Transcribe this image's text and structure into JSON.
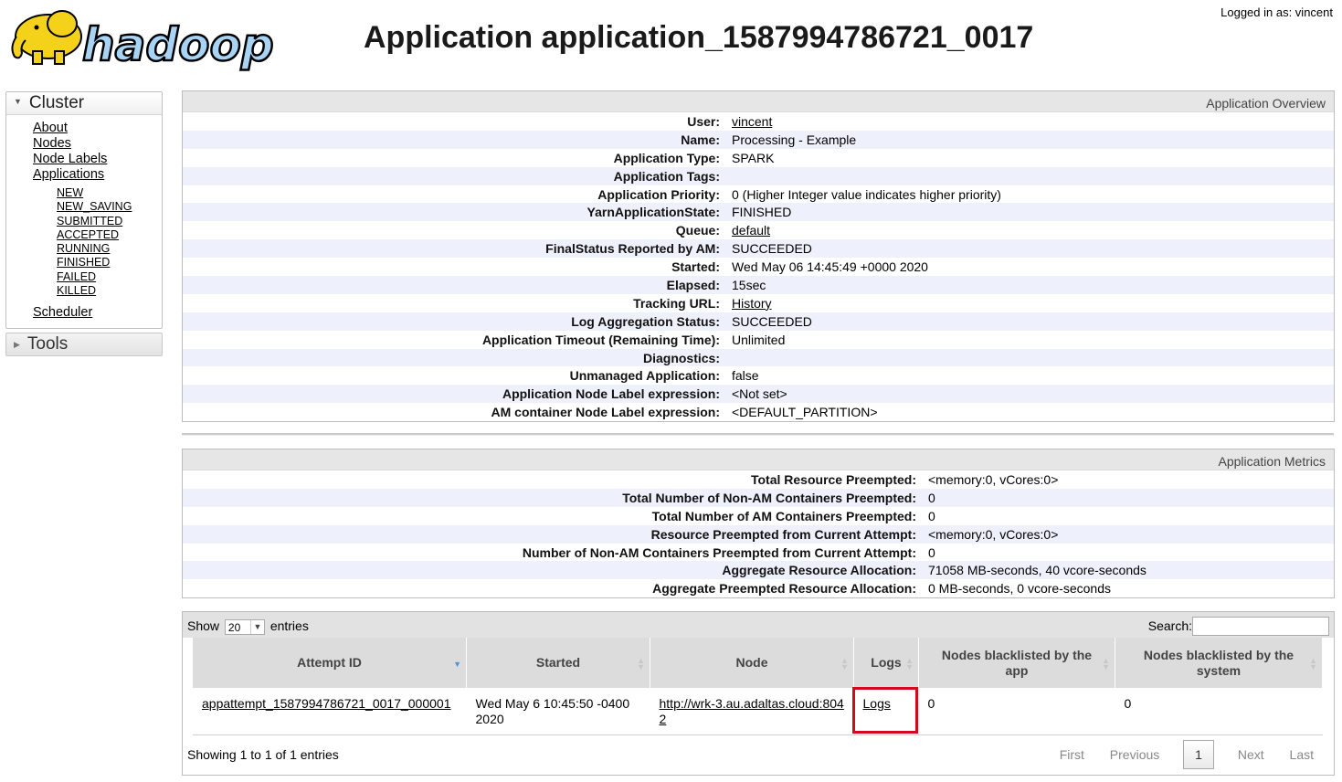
{
  "header": {
    "logo_text": "hadoop",
    "title": "Application application_1587994786721_0017",
    "login": "Logged in as: vincent"
  },
  "nav": {
    "cluster_label": "Cluster",
    "items": [
      "About",
      "Nodes",
      "Node Labels",
      "Applications"
    ],
    "states": [
      "NEW",
      "NEW_SAVING",
      "SUBMITTED",
      "ACCEPTED",
      "RUNNING",
      "FINISHED",
      "FAILED",
      "KILLED"
    ],
    "scheduler": "Scheduler",
    "tools_label": "Tools"
  },
  "overview": {
    "title": "Application Overview",
    "rows": [
      {
        "k": "User:",
        "v": "vincent",
        "link": true
      },
      {
        "k": "Name:",
        "v": "Processing - Example",
        "link": false
      },
      {
        "k": "Application Type:",
        "v": "SPARK",
        "link": false
      },
      {
        "k": "Application Tags:",
        "v": "",
        "link": false
      },
      {
        "k": "Application Priority:",
        "v": "0 (Higher Integer value indicates higher priority)",
        "link": false
      },
      {
        "k": "YarnApplicationState:",
        "v": "FINISHED",
        "link": false
      },
      {
        "k": "Queue:",
        "v": "default",
        "link": true
      },
      {
        "k": "FinalStatus Reported by AM:",
        "v": "SUCCEEDED",
        "link": false
      },
      {
        "k": "Started:",
        "v": "Wed May 06 14:45:49 +0000 2020",
        "link": false
      },
      {
        "k": "Elapsed:",
        "v": "15sec",
        "link": false
      },
      {
        "k": "Tracking URL:",
        "v": "History",
        "link": true
      },
      {
        "k": "Log Aggregation Status:",
        "v": "SUCCEEDED",
        "link": false
      },
      {
        "k": "Application Timeout (Remaining Time):",
        "v": "Unlimited",
        "link": false
      },
      {
        "k": "Diagnostics:",
        "v": "",
        "link": false
      },
      {
        "k": "Unmanaged Application:",
        "v": "false",
        "link": false
      },
      {
        "k": "Application Node Label expression:",
        "v": "<Not set>",
        "link": false
      },
      {
        "k": "AM container Node Label expression:",
        "v": "<DEFAULT_PARTITION>",
        "link": false
      }
    ]
  },
  "metrics": {
    "title": "Application Metrics",
    "rows": [
      {
        "k": "Total Resource Preempted:",
        "v": "<memory:0, vCores:0>"
      },
      {
        "k": "Total Number of Non-AM Containers Preempted:",
        "v": "0"
      },
      {
        "k": "Total Number of AM Containers Preempted:",
        "v": "0"
      },
      {
        "k": "Resource Preempted from Current Attempt:",
        "v": "<memory:0, vCores:0>"
      },
      {
        "k": "Number of Non-AM Containers Preempted from Current Attempt:",
        "v": "0"
      },
      {
        "k": "Aggregate Resource Allocation:",
        "v": "71058 MB-seconds, 40 vcore-seconds"
      },
      {
        "k": "Aggregate Preempted Resource Allocation:",
        "v": "0 MB-seconds, 0 vcore-seconds"
      }
    ]
  },
  "attempts": {
    "show_label": "Show",
    "show_value": "20",
    "entries_label": "entries",
    "search_label": "Search:",
    "columns": [
      "Attempt ID",
      "Started",
      "Node",
      "Logs",
      "Nodes blacklisted by the app",
      "Nodes blacklisted by the system"
    ],
    "rows": [
      {
        "attempt_id": "appattempt_1587994786721_0017_000001",
        "started": "Wed May 6 10:45:50 -0400 2020",
        "node": "http://wrk-3.au.adaltas.cloud:8042",
        "logs": "Logs",
        "bl_app": "0",
        "bl_system": "0"
      }
    ],
    "info": "Showing 1 to 1 of 1 entries",
    "pager": {
      "first": "First",
      "previous": "Previous",
      "current": "1",
      "next": "Next",
      "last": "Last"
    }
  }
}
